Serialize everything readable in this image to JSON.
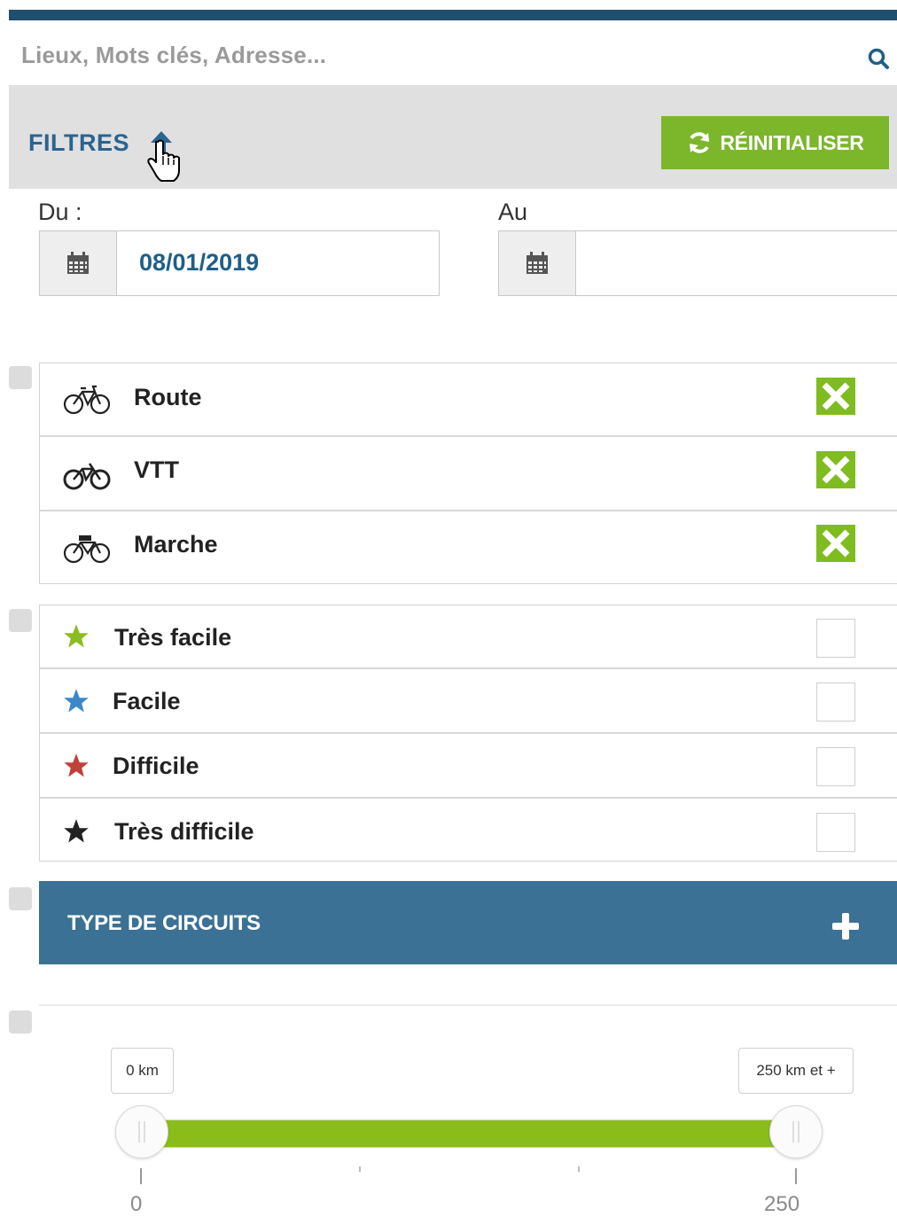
{
  "search": {
    "placeholder": "Lieux, Mots clés, Adresse..."
  },
  "filters": {
    "title": "FILTRES",
    "reset_label": "RÉINITIALISER"
  },
  "dates": {
    "from_label": "Du :",
    "from_value": "08/01/2019",
    "to_label": "Au",
    "to_value": ""
  },
  "activities": [
    {
      "label": "Route",
      "icon": "road-bike-icon",
      "checked": true
    },
    {
      "label": "VTT",
      "icon": "mountain-bike-icon",
      "checked": true
    },
    {
      "label": "Marche",
      "icon": "walk-bike-icon",
      "checked": true
    }
  ],
  "difficulties": [
    {
      "label": "Très facile",
      "color": "#8cbd1f",
      "checked": false
    },
    {
      "label": "Facile",
      "color": "#3d88c8",
      "checked": false
    },
    {
      "label": "Difficile",
      "color": "#c0413a",
      "checked": false
    },
    {
      "label": "Très difficile",
      "color": "#222222",
      "checked": false
    }
  ],
  "circuit_type": {
    "label": "TYPE DE CIRCUITS"
  },
  "distance": {
    "min_label": "0 km",
    "max_label": "250 km et +",
    "range_min": 0,
    "range_max": 250,
    "selected_min": 0,
    "selected_max": 250,
    "tick_min": "0",
    "tick_max": "250"
  },
  "colors": {
    "primary": "#3a7194",
    "accent": "#7bb62b",
    "header": "#1f4f6e"
  }
}
